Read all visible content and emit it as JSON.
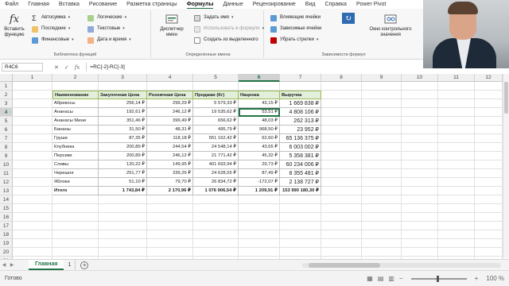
{
  "menu": [
    "Файл",
    "Главная",
    "Вставка",
    "Рисование",
    "Разметка страницы",
    "Формулы",
    "Данные",
    "Рецензирование",
    "Вид",
    "Справка",
    "Power Pivot"
  ],
  "active_menu": "Формулы",
  "ribbon": {
    "insert_function": "Вставить функцию",
    "autosum": "Автосумма",
    "recent": "Последние",
    "financial": "Финансовые",
    "logical": "Логические",
    "text": "Текстовые",
    "datetime": "Дата и время",
    "library_group": "Библиотека функций",
    "name_manager": "Диспетчер имен",
    "define_name": "Задать имя",
    "use_in_formula": "Использовать в формуле",
    "create_from_selection": "Создать из выделенного",
    "names_group": "Определенные имена",
    "trace_precedents": "Влияющие ячейки",
    "trace_dependents": "Зависимые ячейки",
    "remove_arrows": "Убрать стрелки",
    "watch_window": "Окно контрольного значения",
    "audit_group": "Зависимости формул"
  },
  "formula_bar": {
    "name_box": "R4C6",
    "formula": "=RC[-2]-RC[-3]"
  },
  "columns": [
    "1",
    "2",
    "3",
    "4",
    "5",
    "6",
    "7",
    "8",
    "9",
    "10",
    "11",
    "12"
  ],
  "selected_column": "6",
  "rows": [
    "1",
    "2",
    "3",
    "4",
    "5",
    "6",
    "7",
    "8",
    "9",
    "10",
    "11",
    "12",
    "13",
    "14",
    "15",
    "16",
    "17",
    "18",
    "19",
    "20",
    "21"
  ],
  "selected_row": "4",
  "table": {
    "headers": [
      "Наименование",
      "Закупочная Цена",
      "Розничная Цена",
      "Продажи (Кг)",
      "Наценка",
      "Выручка"
    ],
    "rows": [
      [
        "Абрикосы",
        "256,14 ₽",
        "299,29 ₽",
        "5 579,33 ₽",
        "43,15 ₽",
        "1 669 838 ₽"
      ],
      [
        "Ананасы",
        "192,61 ₽",
        "246,12 ₽",
        "19 535,62 ₽",
        "53,51 ₽",
        "4 808 106 ₽"
      ],
      [
        "Ананасы Мини",
        "351,46 ₽",
        "399,49 ₽",
        "656,62 ₽",
        "48,03 ₽",
        "262 313 ₽"
      ],
      [
        "Бананы",
        "31,50 ₽",
        "48,31 ₽",
        "495,79 ₽",
        "968,50 ₽",
        "23 952 ₽"
      ],
      [
        "Груши",
        "87,35 ₽",
        "118,18 ₽",
        "551 162,42 ₽",
        "62,60 ₽",
        "65 136 375 ₽"
      ],
      [
        "Клубника",
        "200,89 ₽",
        "244,54 ₽",
        "24 548,14 ₽",
        "43,65 ₽",
        "6 003 002 ₽"
      ],
      [
        "Персики",
        "200,89 ₽",
        "246,12 ₽",
        "21 771,42 ₽",
        "45,32 ₽",
        "5 358 381 ₽"
      ],
      [
        "Сливы",
        "120,22 ₽",
        "149,95 ₽",
        "401 693,94 ₽",
        "29,73 ₽",
        "60 234 006 ₽"
      ],
      [
        "Черешня",
        "251,77 ₽",
        "339,26 ₽",
        "24 628,55 ₽",
        "87,49 ₽",
        "8 355 481 ₽"
      ],
      [
        "Яблоки",
        "51,10 ₽",
        "79,70 ₽",
        "26 834,72 ₽",
        "-172,07 ₽",
        "2 138 727 ₽"
      ]
    ],
    "total": [
      "Итого",
      "1 743,84 ₽",
      "2 170,96 ₽",
      "1 076 906,54 ₽",
      "1 209,91 ₽",
      "153 990 180,30 ₽"
    ]
  },
  "sheet_tabs": [
    "Главная",
    "1"
  ],
  "status": {
    "ready": "Готово",
    "zoom": "100 %"
  },
  "colors": {
    "accent": "#217346",
    "header_fill": "#e2efda"
  }
}
